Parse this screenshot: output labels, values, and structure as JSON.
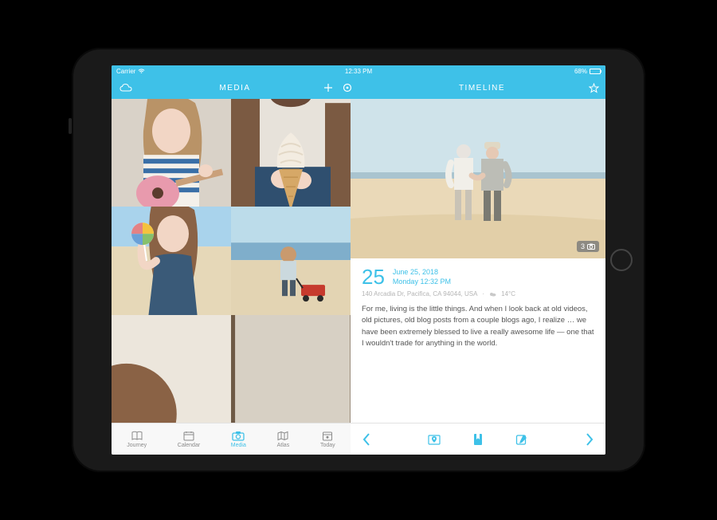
{
  "statusbar": {
    "carrier": "Carrier",
    "time": "12:33 PM",
    "battery_pct": "68%"
  },
  "header": {
    "left_title": "MEDIA",
    "right_title": "TIMELINE"
  },
  "entry": {
    "photo_count": "3",
    "big_day": "25",
    "date_line1": "June 25, 2018",
    "date_line2": "Monday 12:32 PM",
    "location": "140 Arcadia Dr, Pacifica, CA 94044, USA",
    "temp": "14°C",
    "body": "For me, living is the little things. And when I look back at old videos, old pictures, old blog posts from a couple blogs ago, I realize … we have been extremely blessed to live a really awesome life — one that I wouldn't trade for anything in the world."
  },
  "tabs": {
    "journey": "Journey",
    "calendar": "Calendar",
    "media": "Media",
    "atlas": "Atlas",
    "today": "Today"
  }
}
